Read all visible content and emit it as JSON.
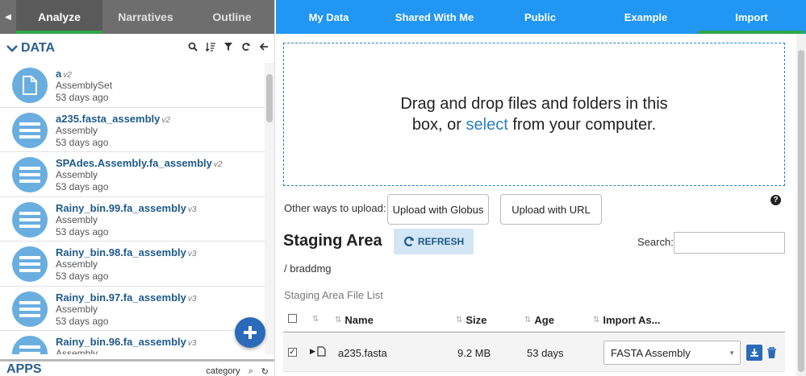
{
  "left_tabs": {
    "collapse_icon": "caret-left-icon",
    "tabs": [
      {
        "label": "Analyze",
        "active": true
      },
      {
        "label": "Narratives"
      },
      {
        "label": "Outline"
      }
    ]
  },
  "data_panel": {
    "title": "DATA",
    "items": [
      {
        "name": "a",
        "version": "v2",
        "type": "AssemblySet",
        "age": "53 days ago",
        "icon": "file-icon"
      },
      {
        "name": "a235.fasta_assembly",
        "version": "v2",
        "type": "Assembly",
        "age": "53 days ago",
        "icon": "assembly-icon"
      },
      {
        "name": "SPAdes.Assembly.fa_assembly",
        "version": "v2",
        "type": "Assembly",
        "age": "53 days ago",
        "icon": "assembly-icon"
      },
      {
        "name": "Rainy_bin.99.fa_assembly",
        "version": "v3",
        "type": "Assembly",
        "age": "53 days ago",
        "icon": "assembly-icon"
      },
      {
        "name": "Rainy_bin.98.fa_assembly",
        "version": "v3",
        "type": "Assembly",
        "age": "53 days ago",
        "icon": "assembly-icon"
      },
      {
        "name": "Rainy_bin.97.fa_assembly",
        "version": "v3",
        "type": "Assembly",
        "age": "53 days ago",
        "icon": "assembly-icon"
      },
      {
        "name": "Rainy_bin.96.fa_assembly",
        "version": "v3",
        "type": "Assembly",
        "age": "",
        "icon": "assembly-icon"
      }
    ]
  },
  "apps_panel": {
    "title": "APPS",
    "category_label": "category"
  },
  "right_tabs": {
    "tabs": [
      {
        "label": "My Data"
      },
      {
        "label": "Shared With Me"
      },
      {
        "label": "Public"
      },
      {
        "label": "Example"
      },
      {
        "label": "Import",
        "active": true
      }
    ]
  },
  "import": {
    "drop_text_1": "Drag and drop files and folders in this box, or",
    "drop_select": "select",
    "drop_text_2": "from your computer.",
    "other_ways_label": "Other ways to upload:",
    "globus_button": "Upload with Globus",
    "url_button": "Upload with URL",
    "help_glyph": "?",
    "staging_title": "Staging Area",
    "refresh_label": "REFRESH",
    "search_label": "Search:",
    "search_value": "",
    "path": "/ braddmg",
    "file_list_label": "Staging Area File List",
    "columns": [
      "Name",
      "Size",
      "Age",
      "Import As..."
    ],
    "rows": [
      {
        "name": "a235.fasta",
        "size": "9.2 MB",
        "age": "53 days",
        "import_as": "FASTA Assembly",
        "checked": true
      }
    ]
  },
  "colors": {
    "accent_blue": "#2196f3",
    "active_green": "#2ea64a",
    "left_tab_gray": "#6e6e6e",
    "item_circle": "#6aaee0",
    "link_blue": "#1f5a8b"
  }
}
